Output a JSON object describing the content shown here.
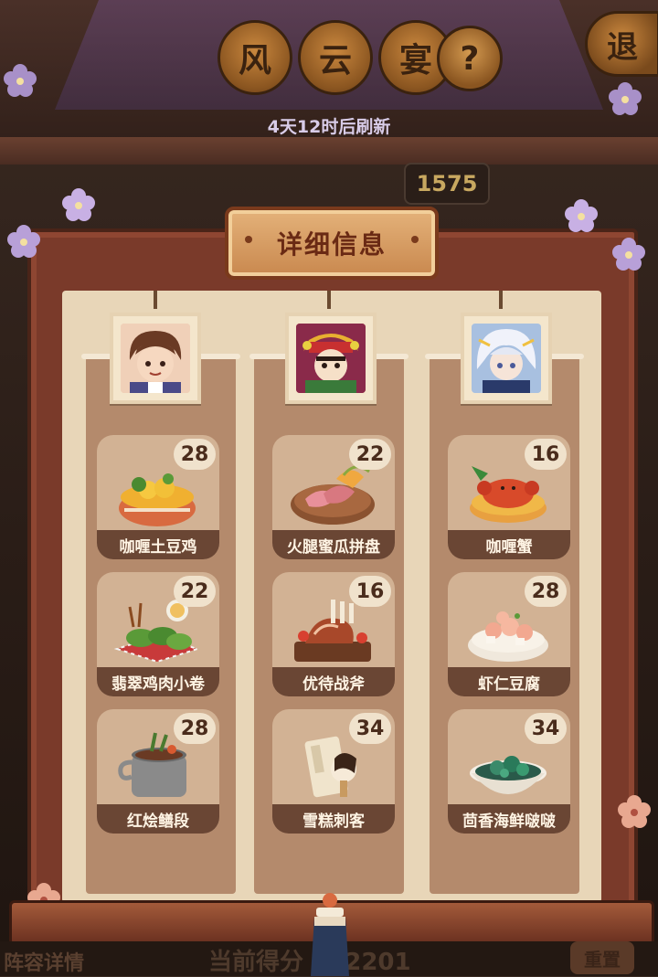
{
  "header": {
    "title_chars": [
      "风",
      "云",
      "宴"
    ],
    "help_symbol": "?",
    "exit_label": "退",
    "refresh_text": "4天12时后刷新",
    "score_value": "1575"
  },
  "panel": {
    "title": "详细信息",
    "columns": [
      {
        "portrait_icon": "character-portrait-brown-hair",
        "dishes": [
          {
            "name": "咖喱土豆鸡",
            "count": "28",
            "icon": "curry-potato-chicken-icon"
          },
          {
            "name": "翡翠鸡肉小卷",
            "count": "22",
            "icon": "jade-chicken-roll-icon"
          },
          {
            "name": "红烩鳝段",
            "count": "28",
            "icon": "braised-eel-icon"
          }
        ]
      },
      {
        "portrait_icon": "character-portrait-opera-mask",
        "dishes": [
          {
            "name": "火腿蜜瓜拼盘",
            "count": "22",
            "icon": "ham-melon-platter-icon"
          },
          {
            "name": "优待战斧",
            "count": "16",
            "icon": "tomahawk-steak-icon"
          },
          {
            "name": "雪糕刺客",
            "count": "34",
            "icon": "ice-cream-assassin-icon"
          }
        ]
      },
      {
        "portrait_icon": "character-portrait-white-hair",
        "dishes": [
          {
            "name": "咖喱蟹",
            "count": "16",
            "icon": "curry-crab-icon"
          },
          {
            "name": "虾仁豆腐",
            "count": "28",
            "icon": "shrimp-tofu-icon"
          },
          {
            "name": "茴香海鲜啵啵",
            "count": "34",
            "icon": "fennel-seafood-bobo-icon"
          }
        ]
      }
    ]
  },
  "footer": {
    "lineup_label": "阵容详情",
    "score_label": "当前得分 892201",
    "right_button": "重置"
  },
  "colors": {
    "panel_frame": "#7a3a2a",
    "panel_inner": "#e8d6b8",
    "card_bg": "#d2b294",
    "card_label": "#6a4634"
  }
}
